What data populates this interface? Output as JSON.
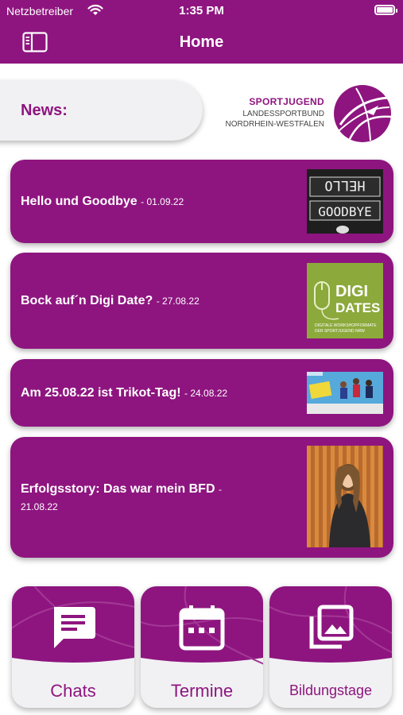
{
  "status_bar": {
    "carrier": "Netzbetreiber",
    "time": "1:35 PM"
  },
  "nav": {
    "title": "Home"
  },
  "news_label": "News:",
  "logo": {
    "line1": "SPORTJUGEND",
    "line2": "LANDESSPORTBUND",
    "line3": "NORDRHEIN-WESTFALEN"
  },
  "news": [
    {
      "title": "Hello und Goodbye",
      "date": "01.09.22",
      "thumb_text": [
        "HELLO",
        "GOODBYE"
      ]
    },
    {
      "title": "Bock auf´n Digi Date?",
      "date": "27.08.22",
      "thumb_text": [
        "DIGI",
        "DATES",
        "DIGITALE WORKSHOPFORMATE",
        "DER SPORTJUGEND NRW"
      ]
    },
    {
      "title": "Am 25.08.22 ist Trikot-Tag!",
      "date": "24.08.22"
    },
    {
      "title": "Erfolgsstory: Das war mein BFD",
      "date": "21.08.22"
    }
  ],
  "tiles": [
    {
      "label": "Chats",
      "icon": "chat-icon"
    },
    {
      "label": "Termine",
      "icon": "calendar-icon"
    },
    {
      "label": "Bildungstage",
      "icon": "photo-library-icon"
    }
  ],
  "colors": {
    "brand_purple": "#8e157f",
    "tile_bottom": "#f1f1f3"
  }
}
